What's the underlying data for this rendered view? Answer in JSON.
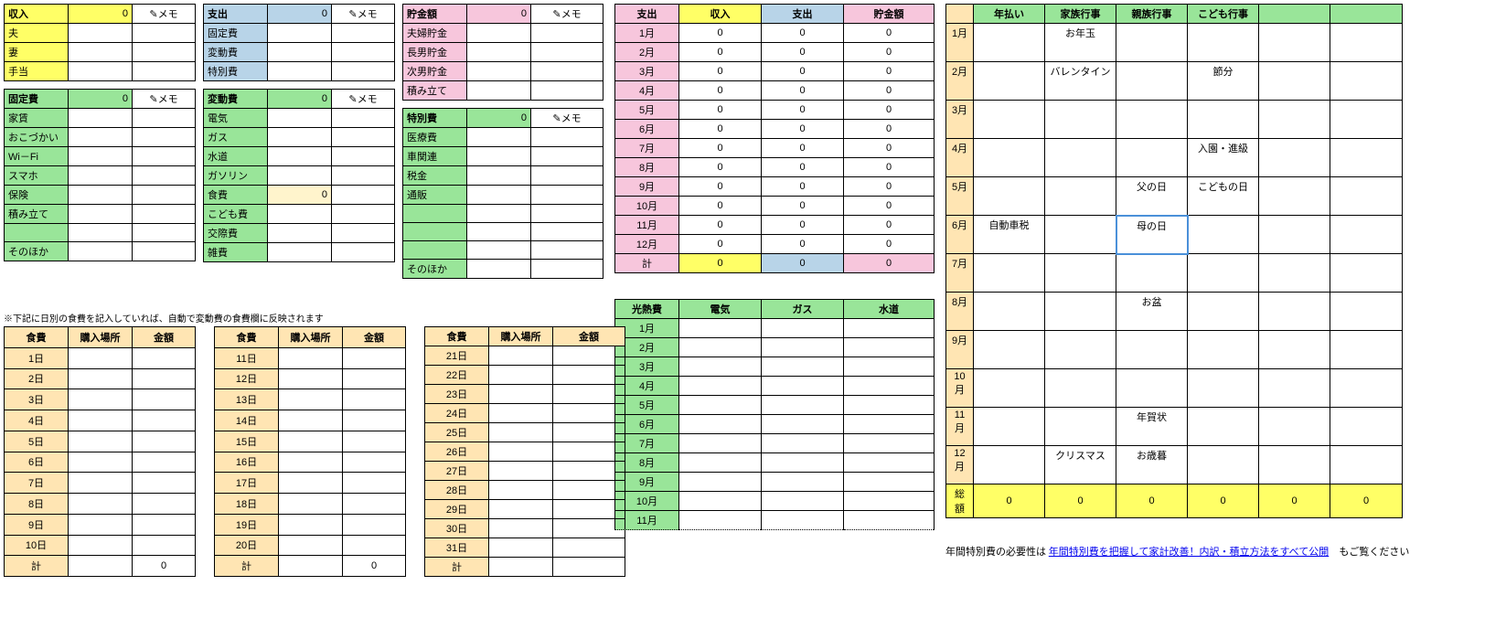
{
  "labels": {
    "memo": "✎メモ",
    "income": "収入",
    "husband": "夫",
    "wife": "妻",
    "allowance": "手当",
    "expense": "支出",
    "fixed": "固定費",
    "variable": "変動費",
    "special": "特別費",
    "savings": "貯金額",
    "couple_sav": "夫婦貯金",
    "son1_sav": "長男貯金",
    "son2_sav": "次男貯金",
    "reserve": "積み立て",
    "rent": "家賃",
    "pocket": "おこづかい",
    "wifi": "Wi－Fi",
    "phone": "スマホ",
    "insurance": "保険",
    "other": "そのほか",
    "elec": "電気",
    "gas": "ガス",
    "water": "水道",
    "gasoline": "ガソリン",
    "food": "食費",
    "kids": "こども費",
    "social": "交際費",
    "misc": "雑費",
    "medical": "医療費",
    "car": "車関連",
    "tax": "税金",
    "mail": "通販",
    "food_hdr": "食費",
    "place": "購入場所",
    "amount": "金額",
    "sum": "計",
    "utility": "光熱費",
    "yearly": "年払い",
    "family_ev": "家族行事",
    "rel_ev": "親族行事",
    "child_ev": "こども行事",
    "total_amt": "総額",
    "food_note": "※下記に日別の食費を記入していれば、自動で変動費の食費欄に反映されます",
    "link_pre": "年間特別費の必要性は",
    "link_text": "年間特別費を把握して家計改善！内訳・積立方法をすべて公開",
    "link_post": "もご覧ください"
  },
  "zero": "0",
  "months": [
    "1月",
    "2月",
    "3月",
    "4月",
    "5月",
    "6月",
    "7月",
    "8月",
    "9月",
    "10月",
    "11月",
    "12月"
  ],
  "days1": [
    "1日",
    "2日",
    "3日",
    "4日",
    "5日",
    "6日",
    "7日",
    "8日",
    "9日",
    "10日"
  ],
  "days2": [
    "11日",
    "12日",
    "13日",
    "14日",
    "15日",
    "16日",
    "17日",
    "18日",
    "19日",
    "20日"
  ],
  "days3": [
    "21日",
    "22日",
    "23日",
    "24日",
    "25日",
    "26日",
    "27日",
    "28日",
    "29日",
    "30日",
    "31日"
  ],
  "events": {
    "1": {
      "family": "お年玉"
    },
    "2": {
      "family": "バレンタイン",
      "child": "節分"
    },
    "4": {
      "child": "入園・進級"
    },
    "5": {
      "rel": "父の日",
      "child": "こどもの日"
    },
    "6": {
      "yearly": "自動車税",
      "rel": "母の日"
    },
    "8": {
      "rel": "お盆"
    },
    "11": {
      "rel": "年賀状"
    },
    "12": {
      "family": "クリスマス",
      "rel": "お歳暮"
    }
  }
}
